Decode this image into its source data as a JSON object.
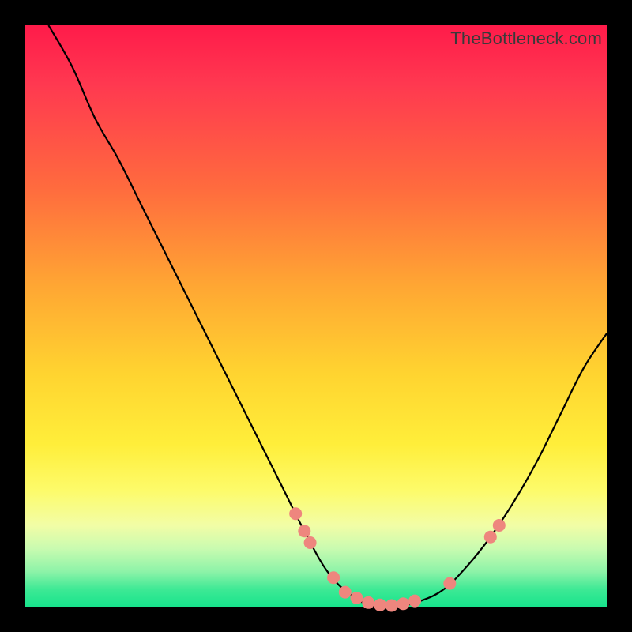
{
  "watermark": "TheBottleneck.com",
  "chart_data": {
    "type": "line",
    "title": "",
    "xlabel": "",
    "ylabel": "",
    "xlim": [
      0,
      100
    ],
    "ylim": [
      0,
      100
    ],
    "grid": false,
    "curve_points": [
      {
        "x": 4,
        "y": 100
      },
      {
        "x": 8,
        "y": 93
      },
      {
        "x": 12,
        "y": 84
      },
      {
        "x": 16,
        "y": 77
      },
      {
        "x": 20,
        "y": 69
      },
      {
        "x": 24,
        "y": 61
      },
      {
        "x": 28,
        "y": 53
      },
      {
        "x": 32,
        "y": 45
      },
      {
        "x": 36,
        "y": 37
      },
      {
        "x": 40,
        "y": 29
      },
      {
        "x": 44,
        "y": 21
      },
      {
        "x": 48,
        "y": 13
      },
      {
        "x": 52,
        "y": 6
      },
      {
        "x": 56,
        "y": 2
      },
      {
        "x": 60,
        "y": 0
      },
      {
        "x": 64,
        "y": 0
      },
      {
        "x": 68,
        "y": 1
      },
      {
        "x": 72,
        "y": 3
      },
      {
        "x": 76,
        "y": 7
      },
      {
        "x": 80,
        "y": 12
      },
      {
        "x": 84,
        "y": 18
      },
      {
        "x": 88,
        "y": 25
      },
      {
        "x": 92,
        "y": 33
      },
      {
        "x": 96,
        "y": 41
      },
      {
        "x": 100,
        "y": 47
      }
    ],
    "marker_points": [
      {
        "x": 46.5,
        "y": 16.0
      },
      {
        "x": 48.0,
        "y": 13.0
      },
      {
        "x": 49.0,
        "y": 11.0
      },
      {
        "x": 53.0,
        "y": 5.0
      },
      {
        "x": 55.0,
        "y": 2.5
      },
      {
        "x": 57.0,
        "y": 1.5
      },
      {
        "x": 59.0,
        "y": 0.7
      },
      {
        "x": 61.0,
        "y": 0.3
      },
      {
        "x": 63.0,
        "y": 0.2
      },
      {
        "x": 65.0,
        "y": 0.5
      },
      {
        "x": 67.0,
        "y": 1.0
      },
      {
        "x": 73.0,
        "y": 4.0
      },
      {
        "x": 80.0,
        "y": 12.0
      },
      {
        "x": 81.5,
        "y": 14.0
      }
    ],
    "annotations": []
  }
}
